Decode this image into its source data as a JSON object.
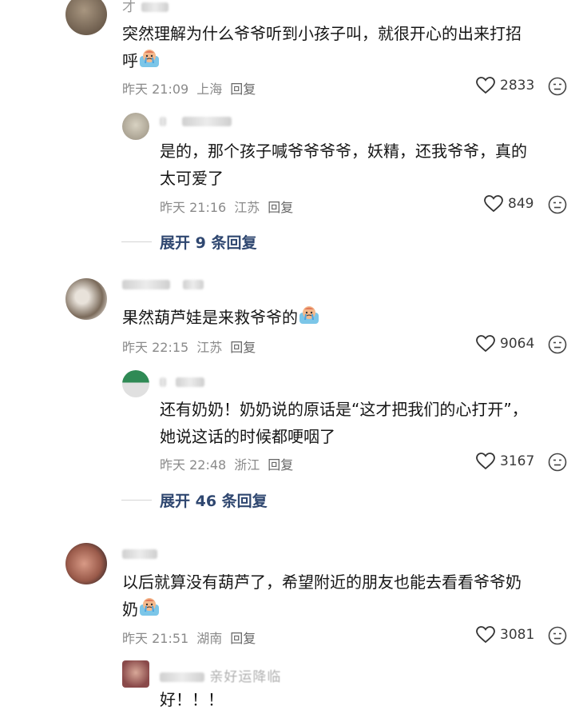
{
  "comments": [
    {
      "user": "才",
      "text_line1": "突然理解为什么爷爷听到小孩子叫，就很开心的出来打招",
      "text_line2": "呼",
      "time": "昨天 21:09",
      "location": "上海",
      "reply_label": "回复",
      "likes": "2833",
      "avatar_color": "#7a6a58",
      "reply": {
        "user": "",
        "text_line1": "是的，那个孩子喊爷爷爷爷，妖精，还我爷爷，真的",
        "text_line2": "太可爱了",
        "time": "昨天 21:16",
        "location": "江苏",
        "reply_label": "回复",
        "likes": "849",
        "avatar_color": "#b9b2a0"
      },
      "expand_label": "展开 9 条回复"
    },
    {
      "user": "",
      "text_line1": "果然葫芦娃是来救爷爷的",
      "time": "昨天 22:15",
      "location": "江苏",
      "reply_label": "回复",
      "likes": "9064",
      "avatar_color": "#8b7a6a",
      "reply": {
        "user": "",
        "text_line1": "还有奶奶！奶奶说的原话是“这才把我们的心打开”，",
        "text_line2": "她说这话的时候都哽咽了",
        "time": "昨天 22:48",
        "location": "浙江",
        "reply_label": "回复",
        "likes": "3167",
        "avatar_color": "#3c8a5a"
      },
      "expand_label": "展开 46 条回复"
    },
    {
      "user": "",
      "text_line1": "以后就算没有葫芦了，希望附近的朋友也能去看看爷爷奶",
      "text_line2": "奶",
      "time": "昨天 21:51",
      "location": "湖南",
      "reply_label": "回复",
      "likes": "3081",
      "avatar_color": "#9a6a5a",
      "reply": {
        "user": "亲好运降临",
        "text_line1": "好！！！",
        "avatar_color": "#8a5a5a"
      }
    }
  ]
}
